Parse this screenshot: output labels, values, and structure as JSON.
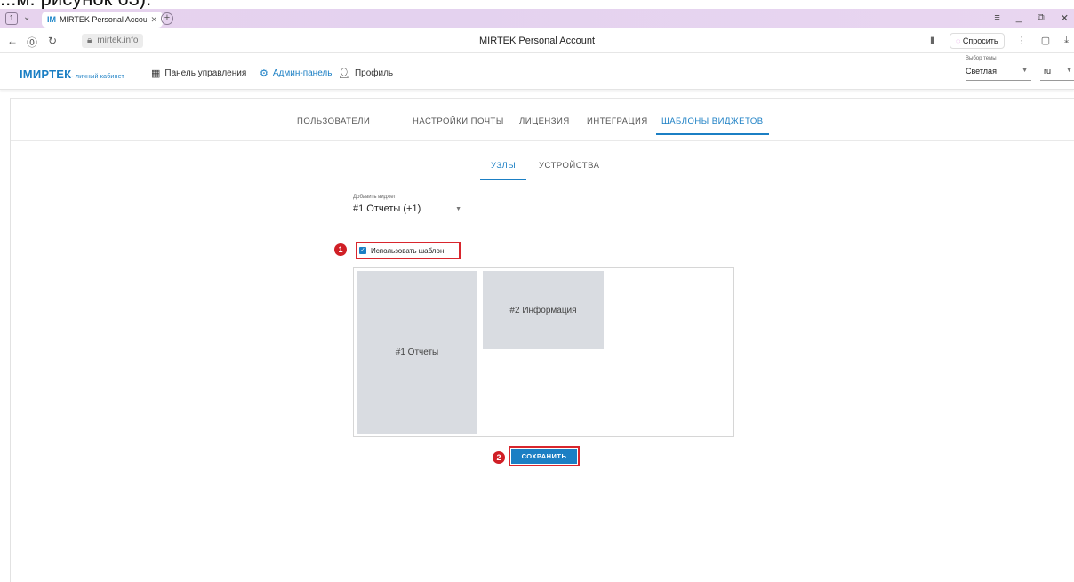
{
  "document": {
    "caption": "...м. рисунок 63)."
  },
  "browser": {
    "tab_count": "1",
    "tab_title": "MIRTEK Personal Accou",
    "tab_favicon": "IM",
    "url": "mirtek.info",
    "page_title": "MIRTEK Personal Account",
    "ask_button": "Спросить"
  },
  "header": {
    "logo": "IMИРТЕК",
    "logo_sub": "- личный кабинет",
    "nav": [
      {
        "label": "Панель управления",
        "icon": "dashboard-icon"
      },
      {
        "label": "Админ-панель",
        "icon": "gear-icon"
      },
      {
        "label": "Профиль",
        "icon": "user-icon"
      }
    ],
    "theme_label": "Выбор темы",
    "theme_value": "Светлая",
    "lang_value": "ru"
  },
  "main": {
    "tabs": [
      {
        "label": "Пользователи",
        "active": false
      },
      {
        "label": "Настройки почты",
        "active": false
      },
      {
        "label": "Лицензия",
        "active": false
      },
      {
        "label": "Интеграция",
        "active": false
      },
      {
        "label": "Шаблоны виджетов",
        "active": true
      }
    ],
    "subtabs": [
      {
        "label": "Узлы",
        "active": true
      },
      {
        "label": "Устройства",
        "active": false
      }
    ],
    "add_widget_label": "Добавить виджет",
    "add_widget_value": "#1 Отчеты (+1)",
    "use_template_label": "Использовать шаблон",
    "use_template_checked": true,
    "widgets": [
      {
        "label": "#1 Отчеты"
      },
      {
        "label": "#2 Информация"
      }
    ],
    "save_label": "Сохранить",
    "markers": [
      "1",
      "2"
    ]
  },
  "colors": {
    "accent": "#1b7fc4",
    "highlight_border": "#d8262d",
    "widget_bg": "#d9dce1",
    "tabstrip": "#e6d3ef"
  }
}
